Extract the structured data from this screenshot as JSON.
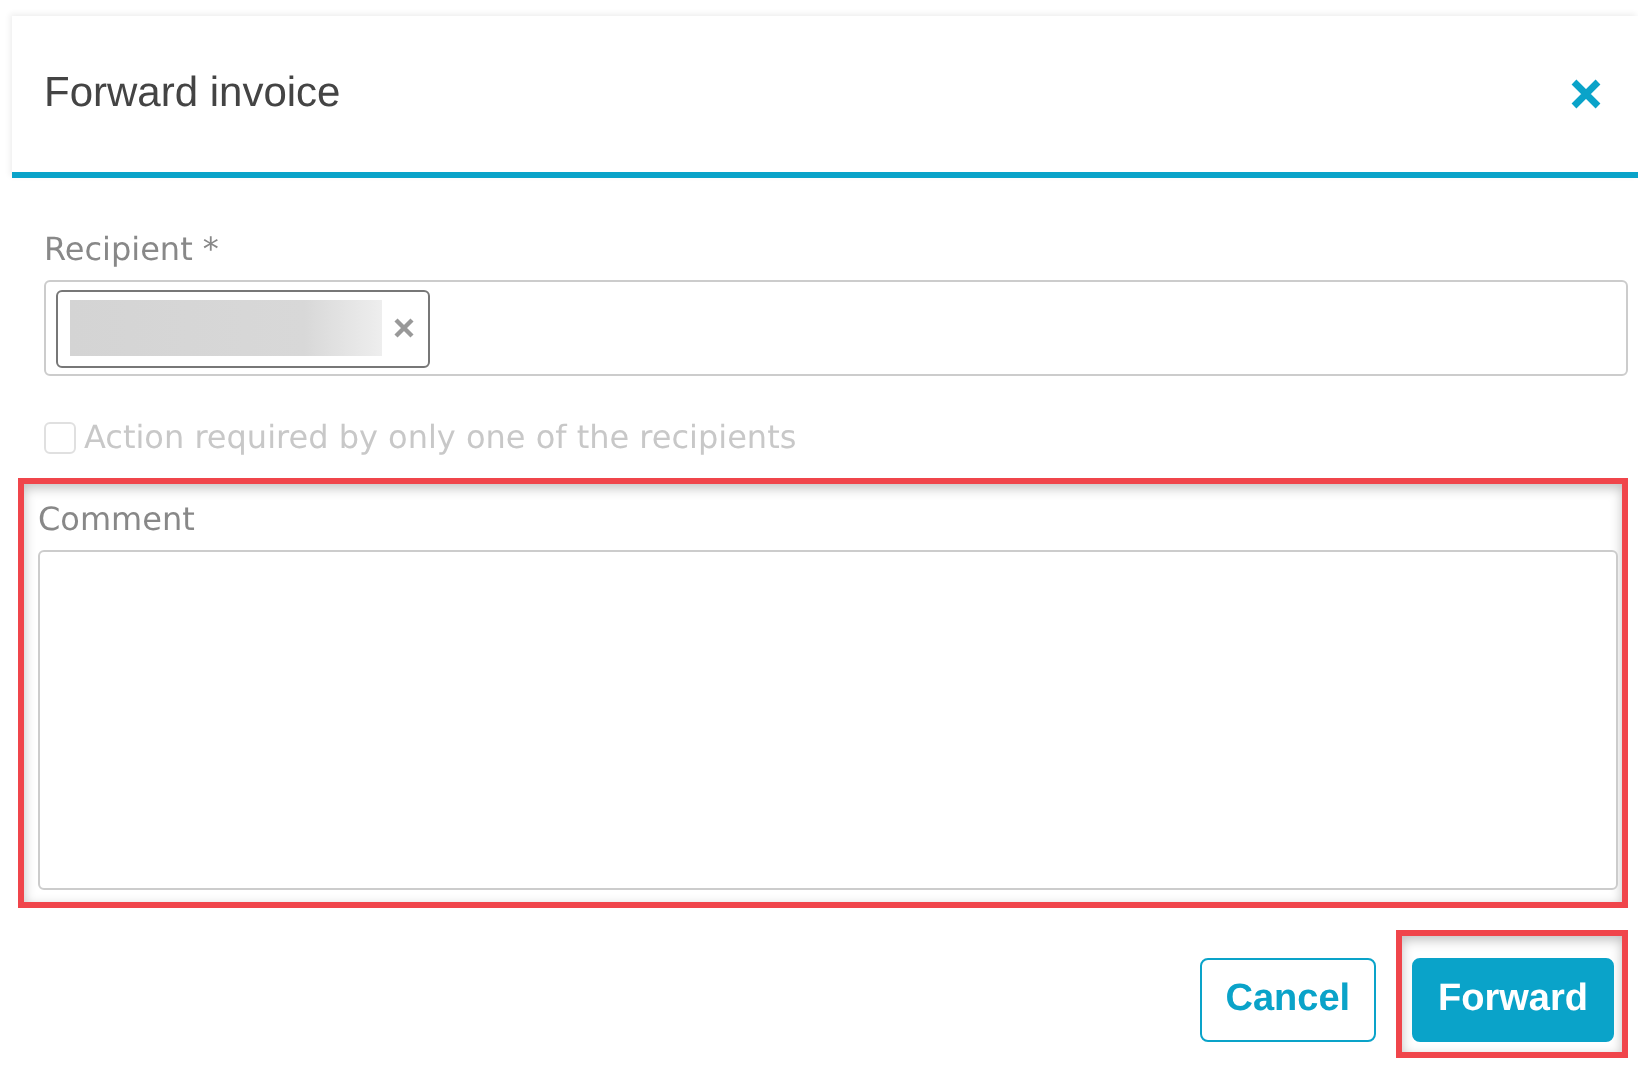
{
  "dialog": {
    "title": "Forward invoice"
  },
  "recipient": {
    "label": "Recipient *",
    "chips": [
      {
        "kind": "redacted"
      }
    ]
  },
  "one_recipient_option": {
    "label": "Action required by only one of the recipients",
    "checked": false,
    "disabled": true
  },
  "comment": {
    "label": "Comment",
    "highlighted": true
  },
  "buttons": [
    {
      "label": "Cancel",
      "kind": "secondary",
      "highlighted": false
    },
    {
      "label": "Forward",
      "kind": "primary",
      "highlighted": true
    }
  ]
}
